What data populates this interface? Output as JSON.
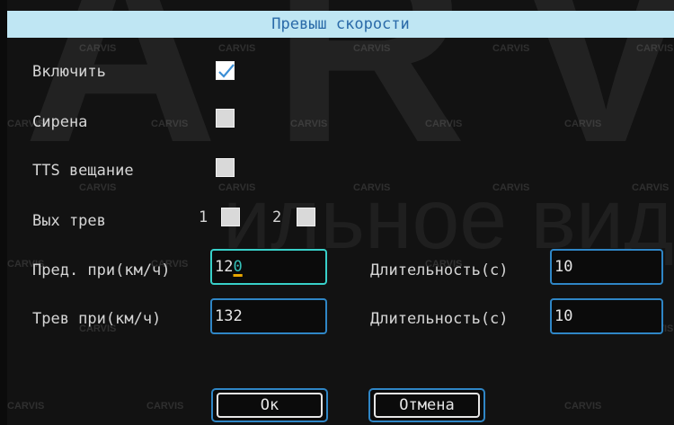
{
  "window": {
    "title": "Превыш скорости"
  },
  "form": {
    "enable": {
      "label": "Включить",
      "checked": true
    },
    "siren": {
      "label": "Сирена",
      "checked": false
    },
    "tts": {
      "label": "TTS вещание",
      "checked": false
    },
    "alarm_out": {
      "label": "Вых трев",
      "options": [
        {
          "label": "1",
          "checked": false
        },
        {
          "label": "2",
          "checked": false
        }
      ]
    },
    "pre_limit": {
      "label": "Пред. при(км/ч)",
      "value_main": "12",
      "value_cursor": "0"
    },
    "pre_duration": {
      "label": "Длительность(с)",
      "value": "10"
    },
    "alarm_limit": {
      "label": "Трев при(км/ч)",
      "value": "132"
    },
    "alarm_duration": {
      "label": "Длительность(с)",
      "value": "10"
    }
  },
  "buttons": {
    "ok": "Ок",
    "cancel": "Отмена"
  },
  "watermark": {
    "big": "ARVIS",
    "mid": "ильное видеонаблю",
    "tag": "CARVIS"
  },
  "colors": {
    "title_bg": "#bfe6f3",
    "title_text": "#2a6aa8",
    "field_border": "#2f86c6",
    "focus_border": "#38d0c9",
    "caret_underline": "#e8a600"
  }
}
